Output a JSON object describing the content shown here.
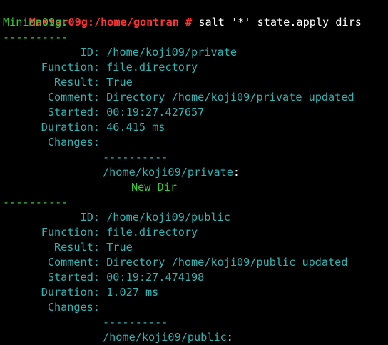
{
  "prompt": {
    "user_host_path": "Master09g:/home/gontran #",
    "command": " salt '*' state.apply dirs"
  },
  "minion": "Minion09g:",
  "separator": "----------",
  "inner_separator": "----------",
  "states": [
    {
      "id_label": "ID:",
      "id": "/home/koji09/private",
      "function_label": "Function:",
      "function": "file.directory",
      "result_label": "Result:",
      "result": "True",
      "comment_label": "Comment:",
      "comment": "Directory /home/koji09/private updated",
      "started_label": "Started:",
      "started": "00:19:27.427657",
      "duration_label": "Duration:",
      "duration": "46.415 ms",
      "changes_label": "Changes:",
      "change_path": "/home/koji09/private",
      "change_colon": ":",
      "change_value": "New Dir"
    },
    {
      "id_label": "ID:",
      "id": "/home/koji09/public",
      "function_label": "Function:",
      "function": "file.directory",
      "result_label": "Result:",
      "result": "True",
      "comment_label": "Comment:",
      "comment": "Directory /home/koji09/public updated",
      "started_label": "Started:",
      "started": "00:19:27.474198",
      "duration_label": "Duration:",
      "duration": "1.027 ms",
      "changes_label": "Changes:",
      "change_path": "/home/koji09/public",
      "change_colon": ":"
    }
  ],
  "colors": {
    "background": "#000000",
    "prompt": "#ff3333",
    "minion": "#33cc33",
    "fields": "#2cb5b5",
    "change_value": "#33cc33"
  }
}
